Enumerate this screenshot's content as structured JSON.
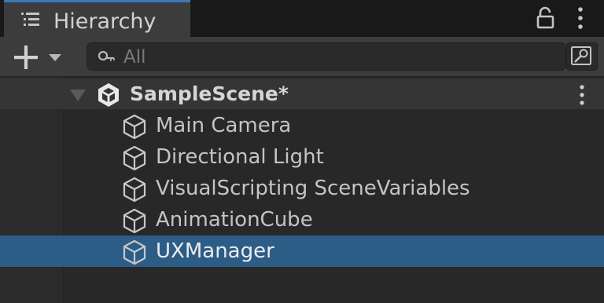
{
  "window": {
    "tab_label": "Hierarchy"
  },
  "toolbar": {
    "add_icon": "plus-icon",
    "search": {
      "placeholder": "All",
      "value": ""
    }
  },
  "hierarchy": {
    "scene": {
      "name": "SampleScene*",
      "icon": "unity-logo-icon",
      "expanded": true
    },
    "items": [
      {
        "label": "Main Camera",
        "icon": "gameobject-cube-icon",
        "selected": false
      },
      {
        "label": "Directional Light",
        "icon": "gameobject-cube-icon",
        "selected": false
      },
      {
        "label": "VisualScripting SceneVariables",
        "icon": "gameobject-cube-icon",
        "selected": false
      },
      {
        "label": "AnimationCube",
        "icon": "gameobject-cube-icon",
        "selected": false
      },
      {
        "label": "UXManager",
        "icon": "gameobject-cube-icon",
        "selected": true
      }
    ]
  },
  "colors": {
    "tab_accent": "#3a79bb",
    "selection": "#2c5d87",
    "background": "#282828"
  }
}
